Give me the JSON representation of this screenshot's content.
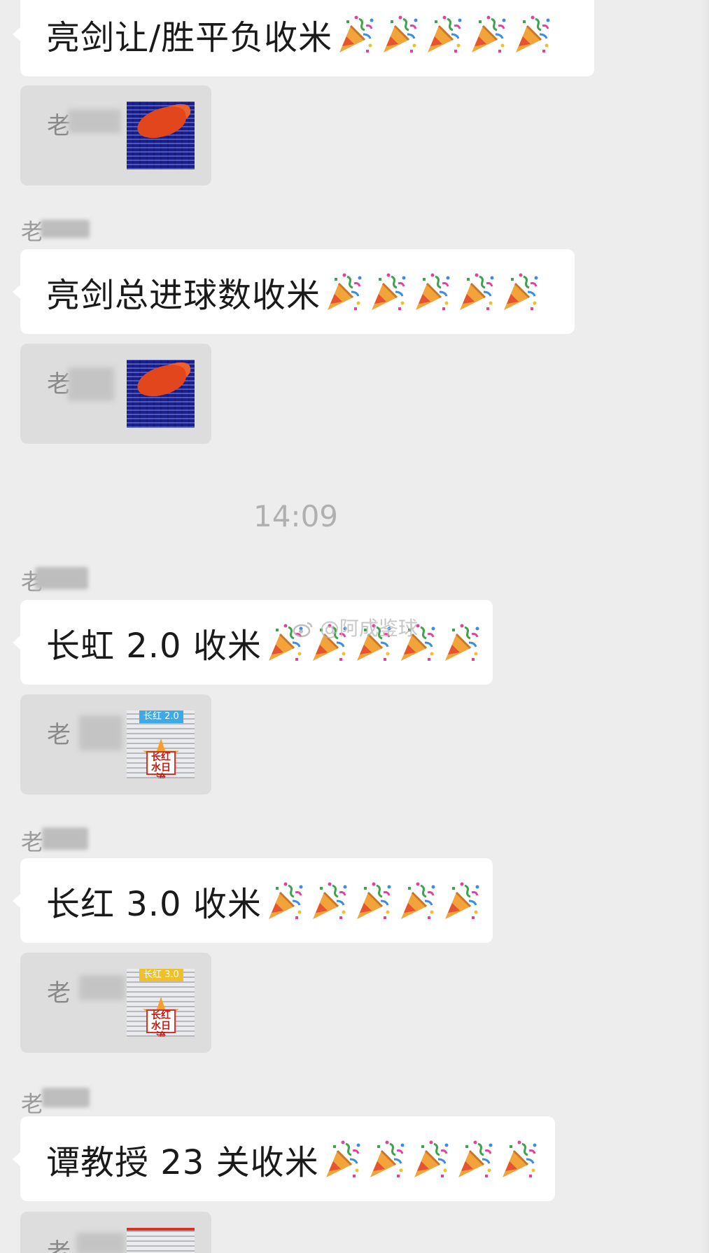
{
  "timestamp": "14:09",
  "watermark": {
    "handle": "@阿成鉴球",
    "icon": "weibo-icon"
  },
  "party_icon": "party-popper-icon",
  "messages": [
    {
      "sender": "老",
      "text": "亮剑让/胜平负收米",
      "emoji_count": 5
    },
    {
      "sender": "老",
      "text": "亮剑总进球数收米",
      "emoji_count": 5
    },
    {
      "sender": "老",
      "text": "长虹 2.0 收米",
      "emoji_count": 5
    },
    {
      "sender": "老",
      "text": "长红 3.0 收米",
      "emoji_count": 5
    },
    {
      "sender": "老",
      "text": "谭教授 23 关收米",
      "emoji_count": 5
    }
  ],
  "cards": [
    {
      "label": "老",
      "image": "lottery-ticket-thumbnail"
    },
    {
      "label": "老",
      "image": "lottery-ticket-thumbnail"
    },
    {
      "label": "老",
      "image": "lottery-ticket-thumbnail",
      "tag": "长红 2.0",
      "logo": "长红\n水日流"
    },
    {
      "label": "老",
      "image": "lottery-ticket-thumbnail",
      "tag": "长红 3.0",
      "logo": "长红\n水日流"
    },
    {
      "label": "老",
      "image": "lottery-ticket-thumbnail"
    }
  ]
}
